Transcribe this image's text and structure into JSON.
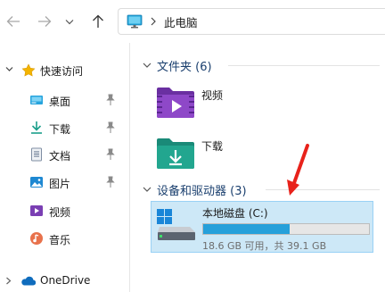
{
  "toolbar": {
    "back_icon": "arrow-left-icon",
    "forward_icon": "arrow-right-icon",
    "recent_icon": "chevron-down-icon",
    "up_icon": "arrow-up-icon"
  },
  "address_bar": {
    "location_icon": "monitor-icon",
    "path": "此电脑"
  },
  "sidebar": {
    "quick_access": {
      "label": "快速访问",
      "icon": "star-icon"
    },
    "items": [
      {
        "label": "桌面",
        "icon": "desktop-folder-icon",
        "pinned": true
      },
      {
        "label": "下载",
        "icon": "download-arrow-icon",
        "pinned": true
      },
      {
        "label": "文档",
        "icon": "document-icon",
        "pinned": true
      },
      {
        "label": "图片",
        "icon": "pictures-icon",
        "pinned": true
      },
      {
        "label": "视频",
        "icon": "video-icon",
        "pinned": false
      },
      {
        "label": "音乐",
        "icon": "music-icon",
        "pinned": false
      }
    ],
    "onedrive": {
      "label": "OneDrive",
      "icon": "cloud-icon"
    }
  },
  "main": {
    "folders_group": {
      "title": "文件夹 (6)",
      "items": [
        {
          "label": "视频",
          "icon": "video-folder-icon"
        },
        {
          "label": "下载",
          "icon": "download-folder-icon"
        }
      ]
    },
    "drives_group": {
      "title": "设备和驱动器 (3)",
      "drive": {
        "name": "本地磁盘 (C:)",
        "free_text": "18.6 GB 可用，共 39.1 GB",
        "used_fraction": 0.524,
        "icon": "windows-drive-icon"
      }
    }
  },
  "colors": {
    "accent": "#26a0da",
    "selection": "#cde8f7",
    "annotation_arrow": "#e8221b",
    "group_title": "#1a3f6e"
  }
}
